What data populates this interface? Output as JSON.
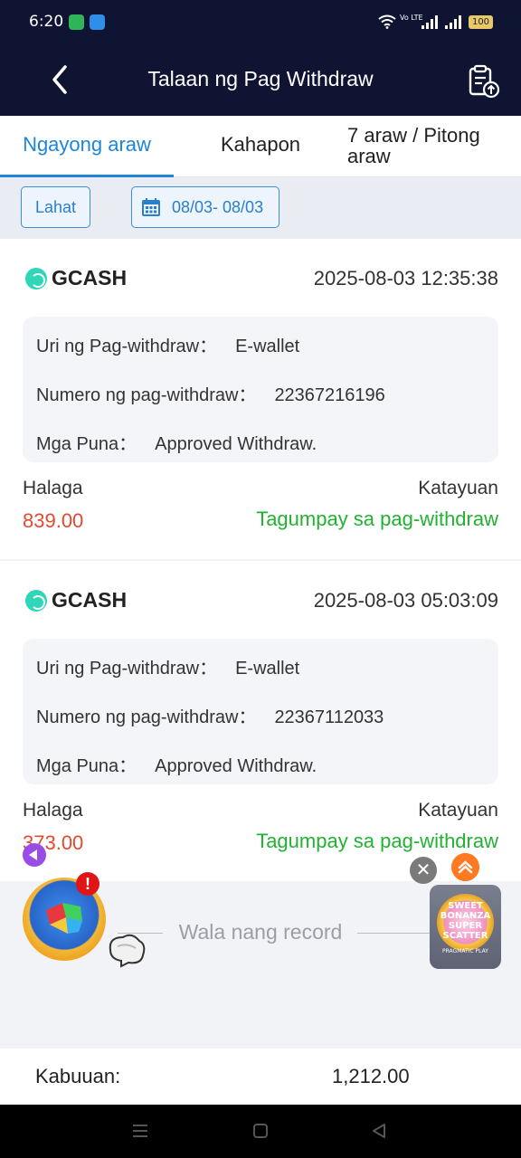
{
  "status_bar": {
    "time": "6:20",
    "volte": "Vo LTE",
    "battery": "100"
  },
  "header": {
    "title": "Talaan ng Pag Withdraw"
  },
  "tabs": [
    {
      "label": "Ngayong araw",
      "active": true
    },
    {
      "label": "Kahapon",
      "active": false
    },
    {
      "label": "7 araw / Pitong araw",
      "active": false
    }
  ],
  "filters": {
    "all_label": "Lahat",
    "date_range": "08/03- 08/03"
  },
  "records": [
    {
      "method": "GCASH",
      "datetime": "2025-08-03 12:35:38",
      "type_label": "Uri ng Pag-withdraw：",
      "type_value": "E-wallet",
      "number_label": "Numero ng pag-withdraw：",
      "number_value": "22367216196",
      "remarks_label": "Mga Puna：",
      "remarks_value": "Approved Withdraw.",
      "amount_label": "Halaga",
      "amount": "839.00",
      "status_label": "Katayuan",
      "status": "Tagumpay sa pag-withdraw"
    },
    {
      "method": "GCASH",
      "datetime": "2025-08-03 05:03:09",
      "type_label": "Uri ng Pag-withdraw：",
      "type_value": "E-wallet",
      "number_label": "Numero ng pag-withdraw：",
      "number_value": "22367112033",
      "remarks_label": "Mga Puna：",
      "remarks_value": "Approved Withdraw.",
      "amount_label": "Halaga",
      "amount": "373.00",
      "status_label": "Katayuan",
      "status": "Tagumpay sa pag-withdraw"
    }
  ],
  "empty_text": "Wala nang record",
  "total": {
    "label": "Kabuuan:",
    "value": "1,212.00"
  },
  "floating": {
    "badge": "!",
    "close": "✕",
    "promo_title": "SWEET BONANZA SUPER SCATTER",
    "promo_brand": "PRAGMATIC PLAY"
  },
  "colors": {
    "header_bg": "#0f1433",
    "accent": "#1e86d6",
    "amount": "#e24a2f",
    "success": "#21b232"
  }
}
